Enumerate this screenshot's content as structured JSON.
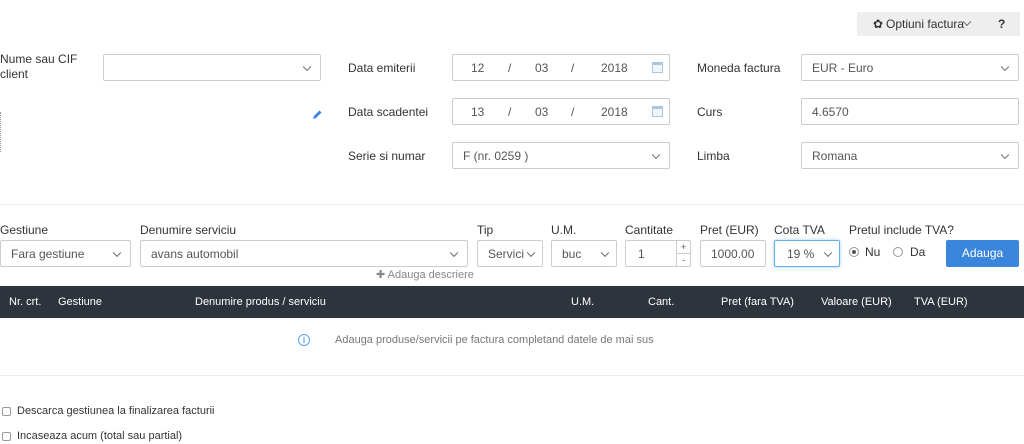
{
  "toolbar": {
    "options_label": "Optiuni factura",
    "help_icon_label": "?"
  },
  "client": {
    "label": "Nume sau CIF client",
    "value": ""
  },
  "dates": {
    "issue_label": "Data emiterii",
    "issue_day": "12",
    "issue_month": "03",
    "issue_year": "2018",
    "due_label": "Data scadentei",
    "due_day": "13",
    "due_month": "03",
    "due_year": "2018",
    "separator": "/"
  },
  "series": {
    "label": "Serie si numar",
    "value": "F (nr. 0259 )"
  },
  "currency": {
    "label": "Moneda factura",
    "value": "EUR - Euro"
  },
  "rate": {
    "label": "Curs",
    "value": "4.6570"
  },
  "language": {
    "label": "Limba",
    "value": "Romana"
  },
  "line_form": {
    "stock_label": "Gestiune",
    "stock_value": "Fara gestiune",
    "service_label": "Denumire serviciu",
    "service_value": "avans automobil",
    "type_label": "Tip",
    "type_value": "Servicii",
    "um_label": "U.M.",
    "um_value": "buc",
    "qty_label": "Cantitate",
    "qty_value": "1",
    "qty_plus": "+",
    "qty_minus": "-",
    "price_label": "Pret (EUR)",
    "price_value": "1000.00",
    "vat_label": "Cota TVA",
    "vat_value": "19 %",
    "vat_included_label": "Pretul include TVA?",
    "vat_no": "Nu",
    "vat_yes": "Da",
    "add_button": "Adauga",
    "add_description": "Adauga descriere"
  },
  "table": {
    "headers": [
      "Nr. crt.",
      "Gestiune",
      "Denumire produs / serviciu",
      "U.M.",
      "Cant.",
      "Pret (fara TVA)",
      "Valoare (EUR)",
      "TVA (EUR)"
    ],
    "empty_message": "Adauga produse/servicii pe factura completand datele de mai sus"
  },
  "options": {
    "unload_stock": "Descarca gestiunea la finalizarea facturii",
    "collect_now": "Incaseaza acum (total sau partial)"
  },
  "colors": {
    "accent": "#3b86dd",
    "header_bg": "#2e343c",
    "info": "#5aa2e0"
  }
}
